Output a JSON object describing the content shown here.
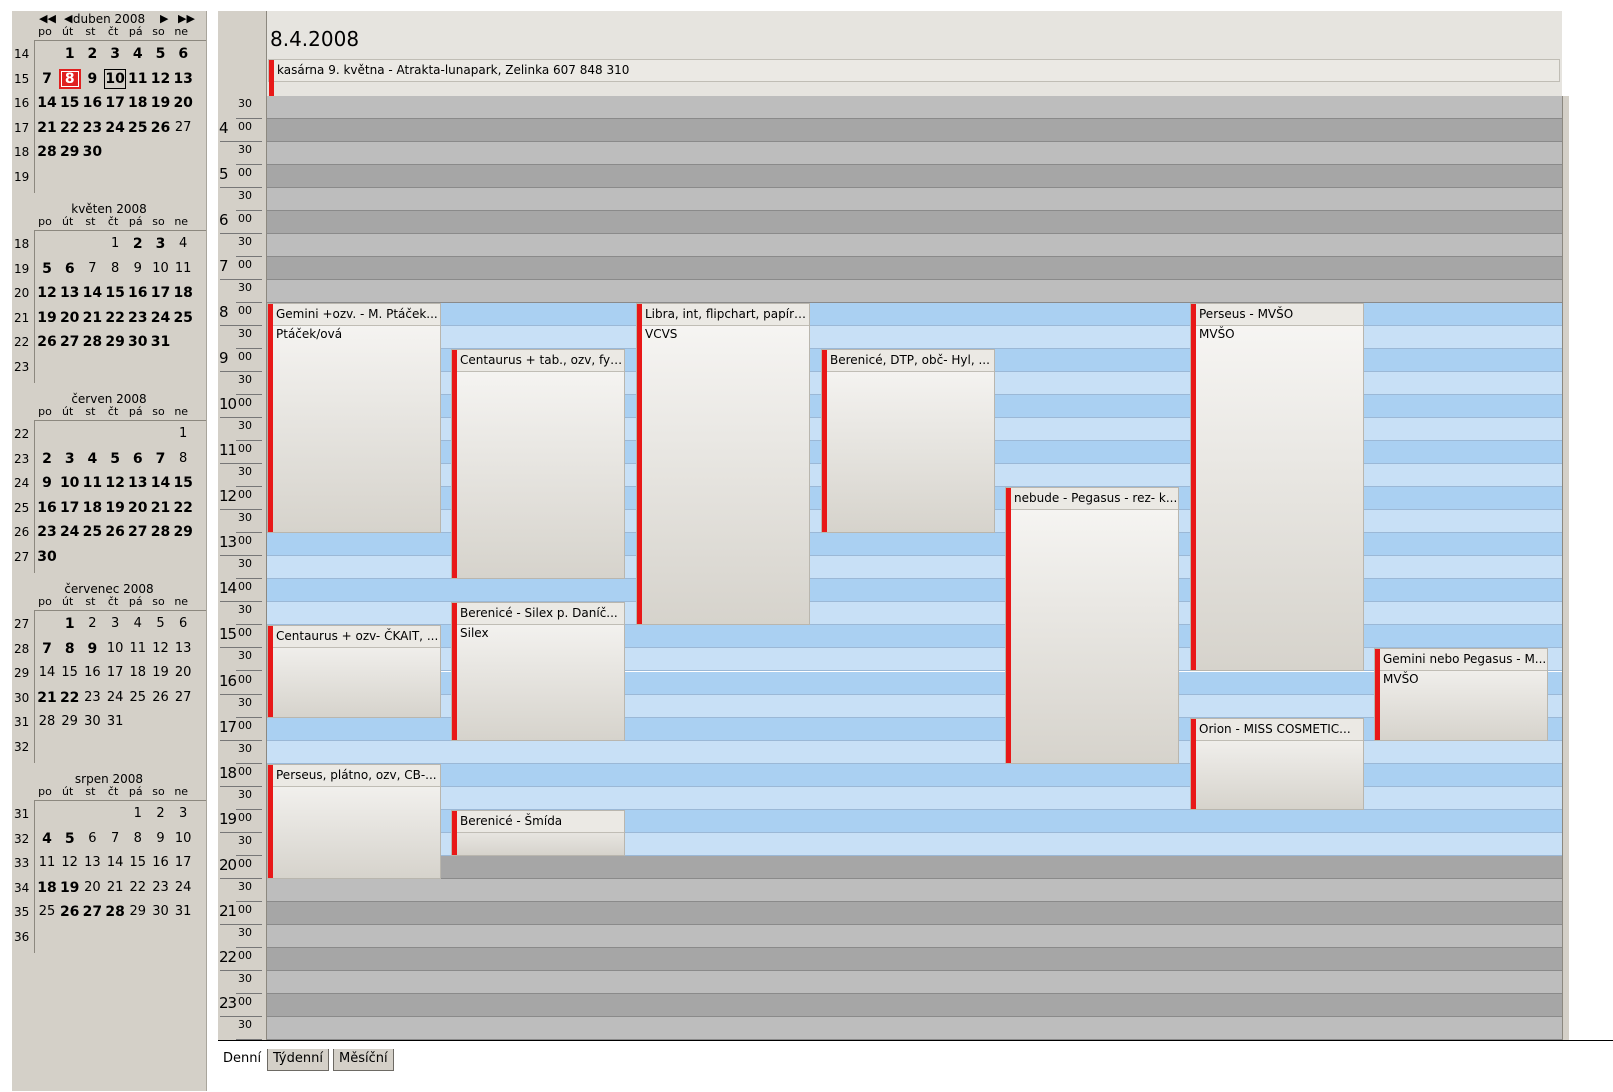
{
  "colors": {
    "accent_bar": "#e81818",
    "working_slot": "#aad0f2",
    "off_slot": "#a6a6a6"
  },
  "weekday_headers": [
    "po",
    "út",
    "st",
    "čt",
    "pá",
    "so",
    "ne"
  ],
  "mini_calendars": [
    {
      "title": "duben 2008",
      "nav": true,
      "weeks": [
        {
          "num": "14",
          "days": [
            [
              "",
              ""
            ],
            [
              "1",
              "b"
            ],
            [
              "2",
              "b"
            ],
            [
              "3",
              "b"
            ],
            [
              "4",
              "b"
            ],
            [
              "5",
              "b"
            ],
            [
              "6",
              "b"
            ]
          ]
        },
        {
          "num": "15",
          "days": [
            [
              "7",
              "b"
            ],
            [
              "8",
              "today"
            ],
            [
              "9",
              "b"
            ],
            [
              "10",
              "bsel"
            ],
            [
              "11",
              "b"
            ],
            [
              "12",
              "b"
            ],
            [
              "13",
              "b"
            ]
          ]
        },
        {
          "num": "16",
          "days": [
            [
              "14",
              "b"
            ],
            [
              "15",
              "b"
            ],
            [
              "16",
              "b"
            ],
            [
              "17",
              "b"
            ],
            [
              "18",
              "b"
            ],
            [
              "19",
              "b"
            ],
            [
              "20",
              "b"
            ]
          ]
        },
        {
          "num": "17",
          "days": [
            [
              "21",
              "b"
            ],
            [
              "22",
              "b"
            ],
            [
              "23",
              "b"
            ],
            [
              "24",
              "b"
            ],
            [
              "25",
              "b"
            ],
            [
              "26",
              "b"
            ],
            [
              "27",
              ""
            ]
          ]
        },
        {
          "num": "18",
          "days": [
            [
              "28",
              "b"
            ],
            [
              "29",
              "b"
            ],
            [
              "30",
              "b"
            ]
          ]
        },
        {
          "num": "19",
          "days": []
        }
      ]
    },
    {
      "title": "květen 2008",
      "nav": false,
      "weeks": [
        {
          "num": "18",
          "days": [
            [
              "",
              ""
            ],
            [
              "",
              ""
            ],
            [
              "",
              ""
            ],
            [
              "1",
              ""
            ],
            [
              "2",
              "b"
            ],
            [
              "3",
              "b"
            ],
            [
              "4",
              ""
            ]
          ]
        },
        {
          "num": "19",
          "days": [
            [
              "5",
              "b"
            ],
            [
              "6",
              "b"
            ],
            [
              "7",
              ""
            ],
            [
              "8",
              ""
            ],
            [
              "9",
              ""
            ],
            [
              "10",
              ""
            ],
            [
              "11",
              ""
            ]
          ]
        },
        {
          "num": "20",
          "days": [
            [
              "12",
              "b"
            ],
            [
              "13",
              "b"
            ],
            [
              "14",
              "b"
            ],
            [
              "15",
              "b"
            ],
            [
              "16",
              "b"
            ],
            [
              "17",
              "b"
            ],
            [
              "18",
              "b"
            ]
          ]
        },
        {
          "num": "21",
          "days": [
            [
              "19",
              "b"
            ],
            [
              "20",
              "b"
            ],
            [
              "21",
              "b"
            ],
            [
              "22",
              "b"
            ],
            [
              "23",
              "b"
            ],
            [
              "24",
              "b"
            ],
            [
              "25",
              "b"
            ]
          ]
        },
        {
          "num": "22",
          "days": [
            [
              "26",
              "b"
            ],
            [
              "27",
              "b"
            ],
            [
              "28",
              "b"
            ],
            [
              "29",
              "b"
            ],
            [
              "30",
              "b"
            ],
            [
              "31",
              "b"
            ]
          ]
        },
        {
          "num": "23",
          "days": []
        }
      ]
    },
    {
      "title": "červen 2008",
      "nav": false,
      "weeks": [
        {
          "num": "22",
          "days": [
            [
              "",
              ""
            ],
            [
              "",
              ""
            ],
            [
              "",
              ""
            ],
            [
              "",
              ""
            ],
            [
              "",
              ""
            ],
            [
              "",
              ""
            ],
            [
              "1",
              ""
            ]
          ]
        },
        {
          "num": "23",
          "days": [
            [
              "2",
              "b"
            ],
            [
              "3",
              "b"
            ],
            [
              "4",
              "b"
            ],
            [
              "5",
              "b"
            ],
            [
              "6",
              "b"
            ],
            [
              "7",
              "b"
            ],
            [
              "8",
              ""
            ]
          ]
        },
        {
          "num": "24",
          "days": [
            [
              "9",
              "b"
            ],
            [
              "10",
              "b"
            ],
            [
              "11",
              "b"
            ],
            [
              "12",
              "b"
            ],
            [
              "13",
              "b"
            ],
            [
              "14",
              "b"
            ],
            [
              "15",
              "b"
            ]
          ]
        },
        {
          "num": "25",
          "days": [
            [
              "16",
              "b"
            ],
            [
              "17",
              "b"
            ],
            [
              "18",
              "b"
            ],
            [
              "19",
              "b"
            ],
            [
              "20",
              "b"
            ],
            [
              "21",
              "b"
            ],
            [
              "22",
              "b"
            ]
          ]
        },
        {
          "num": "26",
          "days": [
            [
              "23",
              "b"
            ],
            [
              "24",
              "b"
            ],
            [
              "25",
              "b"
            ],
            [
              "26",
              "b"
            ],
            [
              "27",
              "b"
            ],
            [
              "28",
              "b"
            ],
            [
              "29",
              "b"
            ]
          ]
        },
        {
          "num": "27",
          "days": [
            [
              "30",
              "b"
            ]
          ]
        }
      ]
    },
    {
      "title": "červenec 2008",
      "nav": false,
      "weeks": [
        {
          "num": "27",
          "days": [
            [
              "",
              ""
            ],
            [
              "1",
              "b"
            ],
            [
              "2",
              ""
            ],
            [
              "3",
              ""
            ],
            [
              "4",
              ""
            ],
            [
              "5",
              ""
            ],
            [
              "6",
              ""
            ]
          ]
        },
        {
          "num": "28",
          "days": [
            [
              "7",
              "b"
            ],
            [
              "8",
              "b"
            ],
            [
              "9",
              "b"
            ],
            [
              "10",
              ""
            ],
            [
              "11",
              ""
            ],
            [
              "12",
              ""
            ],
            [
              "13",
              ""
            ]
          ]
        },
        {
          "num": "29",
          "days": [
            [
              "14",
              ""
            ],
            [
              "15",
              ""
            ],
            [
              "16",
              ""
            ],
            [
              "17",
              ""
            ],
            [
              "18",
              ""
            ],
            [
              "19",
              ""
            ],
            [
              "20",
              ""
            ]
          ]
        },
        {
          "num": "30",
          "days": [
            [
              "21",
              "b"
            ],
            [
              "22",
              "b"
            ],
            [
              "23",
              ""
            ],
            [
              "24",
              ""
            ],
            [
              "25",
              ""
            ],
            [
              "26",
              ""
            ],
            [
              "27",
              ""
            ]
          ]
        },
        {
          "num": "31",
          "days": [
            [
              "28",
              ""
            ],
            [
              "29",
              ""
            ],
            [
              "30",
              ""
            ],
            [
              "31",
              ""
            ]
          ]
        },
        {
          "num": "32",
          "days": []
        }
      ]
    },
    {
      "title": "srpen 2008",
      "nav": false,
      "weeks": [
        {
          "num": "31",
          "days": [
            [
              "",
              ""
            ],
            [
              "",
              ""
            ],
            [
              "",
              ""
            ],
            [
              "",
              ""
            ],
            [
              "1",
              ""
            ],
            [
              "2",
              ""
            ],
            [
              "3",
              ""
            ]
          ]
        },
        {
          "num": "32",
          "days": [
            [
              "4",
              "b"
            ],
            [
              "5",
              "b"
            ],
            [
              "6",
              ""
            ],
            [
              "7",
              ""
            ],
            [
              "8",
              ""
            ],
            [
              "9",
              ""
            ],
            [
              "10",
              ""
            ]
          ]
        },
        {
          "num": "33",
          "days": [
            [
              "11",
              ""
            ],
            [
              "12",
              ""
            ],
            [
              "13",
              ""
            ],
            [
              "14",
              ""
            ],
            [
              "15",
              ""
            ],
            [
              "16",
              ""
            ],
            [
              "17",
              ""
            ]
          ]
        },
        {
          "num": "34",
          "days": [
            [
              "18",
              "b"
            ],
            [
              "19",
              "b"
            ],
            [
              "20",
              ""
            ],
            [
              "21",
              ""
            ],
            [
              "22",
              ""
            ],
            [
              "23",
              ""
            ],
            [
              "24",
              ""
            ]
          ]
        },
        {
          "num": "35",
          "days": [
            [
              "25",
              ""
            ],
            [
              "26",
              "b"
            ],
            [
              "27",
              "b"
            ],
            [
              "28",
              "b"
            ],
            [
              "29",
              ""
            ],
            [
              "30",
              ""
            ],
            [
              "31",
              ""
            ]
          ]
        },
        {
          "num": "36",
          "days": []
        }
      ]
    }
  ],
  "day_view": {
    "date_title": "8.4.2008",
    "all_day_event": "kasárna 9. května - Atrakta-lunapark, Zelinka 607 848 310",
    "first_slot_start": "3:30",
    "time_slots": [
      {
        "hour": "",
        "min": "30",
        "working": false
      },
      {
        "hour": "4",
        "min": "00",
        "working": false
      },
      {
        "hour": "",
        "min": "30",
        "working": false
      },
      {
        "hour": "5",
        "min": "00",
        "working": false
      },
      {
        "hour": "",
        "min": "30",
        "working": false
      },
      {
        "hour": "6",
        "min": "00",
        "working": false
      },
      {
        "hour": "",
        "min": "30",
        "working": false
      },
      {
        "hour": "7",
        "min": "00",
        "working": false
      },
      {
        "hour": "",
        "min": "30",
        "working": false
      },
      {
        "hour": "8",
        "min": "00",
        "working": true
      },
      {
        "hour": "",
        "min": "30",
        "working": true
      },
      {
        "hour": "9",
        "min": "00",
        "working": true
      },
      {
        "hour": "",
        "min": "30",
        "working": true
      },
      {
        "hour": "10",
        "min": "00",
        "working": true
      },
      {
        "hour": "",
        "min": "30",
        "working": true
      },
      {
        "hour": "11",
        "min": "00",
        "working": true
      },
      {
        "hour": "",
        "min": "30",
        "working": true
      },
      {
        "hour": "12",
        "min": "00",
        "working": true
      },
      {
        "hour": "",
        "min": "30",
        "working": true
      },
      {
        "hour": "13",
        "min": "00",
        "working": true
      },
      {
        "hour": "",
        "min": "30",
        "working": true
      },
      {
        "hour": "14",
        "min": "00",
        "working": true
      },
      {
        "hour": "",
        "min": "30",
        "working": true
      },
      {
        "hour": "15",
        "min": "00",
        "working": true
      },
      {
        "hour": "",
        "min": "30",
        "working": true
      },
      {
        "hour": "16",
        "min": "00",
        "working": true
      },
      {
        "hour": "",
        "min": "30",
        "working": true
      },
      {
        "hour": "17",
        "min": "00",
        "working": true
      },
      {
        "hour": "",
        "min": "30",
        "working": true
      },
      {
        "hour": "18",
        "min": "00",
        "working": true
      },
      {
        "hour": "",
        "min": "30",
        "working": true
      },
      {
        "hour": "19",
        "min": "00",
        "working": true
      },
      {
        "hour": "",
        "min": "30",
        "working": true
      },
      {
        "hour": "20",
        "min": "00",
        "working": false
      },
      {
        "hour": "",
        "min": "30",
        "working": false
      },
      {
        "hour": "21",
        "min": "00",
        "working": false
      },
      {
        "hour": "",
        "min": "30",
        "working": false
      },
      {
        "hour": "22",
        "min": "00",
        "working": false
      },
      {
        "hour": "",
        "min": "30",
        "working": false
      },
      {
        "hour": "23",
        "min": "00",
        "working": false
      },
      {
        "hour": "",
        "min": "30",
        "working": false
      }
    ],
    "appointments": [
      {
        "title": "Gemini +ozv. - M. Ptáček...",
        "subtitle": "Ptáček/ová",
        "start": "8:00",
        "end": "13:00",
        "column": 0
      },
      {
        "title": "Centaurus + ozv- ČKAIT, ...",
        "subtitle": "",
        "start": "15:00",
        "end": "17:00",
        "column": 0
      },
      {
        "title": "Perseus, plátno, ozv, CB-...",
        "subtitle": "",
        "start": "18:00",
        "end": "20:30",
        "column": 0
      },
      {
        "title": "Centaurus + tab., ozv,  fy ...",
        "subtitle": "",
        "start": "9:00",
        "end": "14:00",
        "column": 1
      },
      {
        "title": "Berenicé - Silex p. Daníč...",
        "subtitle": "Silex",
        "start": "14:30",
        "end": "17:30",
        "column": 1
      },
      {
        "title": "Berenicé - Šmída",
        "subtitle": "",
        "start": "19:00",
        "end": "20:00",
        "column": 1
      },
      {
        "title": "Libra, int, flipchart, papíry ...",
        "subtitle": "VCVS",
        "start": "8:00",
        "end": "15:00",
        "column": 2
      },
      {
        "title": "Berenicé, DTP, obč- Hyl, ...",
        "subtitle": "",
        "start": "9:00",
        "end": "13:00",
        "column": 3
      },
      {
        "title": "nebude - Pegasus - rez- k...",
        "subtitle": "",
        "start": "12:00",
        "end": "18:00",
        "column": 4
      },
      {
        "title": "Perseus - MVŠO",
        "subtitle": "MVŠO",
        "start": "8:00",
        "end": "16:00",
        "column": 5
      },
      {
        "title": "Orion - MISS COSMETIC...",
        "subtitle": "",
        "start": "17:00",
        "end": "19:00",
        "column": 5
      },
      {
        "title": "Gemini nebo Pegasus - M...",
        "subtitle": "MVŠO",
        "start": "15:30",
        "end": "17:30",
        "column": 6
      }
    ]
  },
  "view_tabs": [
    {
      "label": "Denní",
      "active": true
    },
    {
      "label": "Týdenní",
      "active": false
    },
    {
      "label": "Měsíční",
      "active": false
    }
  ]
}
